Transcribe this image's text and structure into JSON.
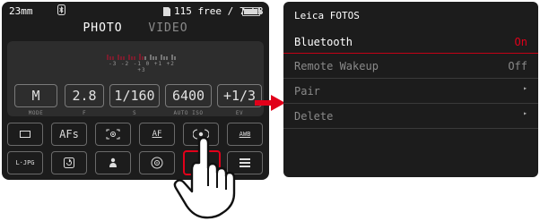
{
  "camera": {
    "focal_length": "23mm",
    "storage_status": "115 free / 7 GB",
    "tabs": [
      {
        "label": "PHOTO",
        "active": true
      },
      {
        "label": "VIDEO",
        "active": false
      }
    ],
    "ev_scale": "-3 -2 -1 0 +1 +2 +3",
    "params": [
      {
        "value": "M",
        "caption": "MODE"
      },
      {
        "value": "2.8",
        "caption": "F"
      },
      {
        "value": "1/160",
        "caption": "S"
      },
      {
        "value": "6400",
        "caption": "AUTO ISO"
      },
      {
        "value": "+1/3",
        "caption": "EV"
      }
    ],
    "quick_row1": [
      {
        "icon": "rect-frame-icon",
        "label": "▭"
      },
      {
        "icon": "af-mode",
        "label": "AFs"
      },
      {
        "icon": "metering-icon",
        "label": "[◉]"
      },
      {
        "icon": "af-settings-icon",
        "label": "AF"
      },
      {
        "icon": "stabilization-icon",
        "label": "((•))"
      },
      {
        "icon": "awb-icon",
        "label": "AWB"
      }
    ],
    "quick_row2": [
      {
        "icon": "file-format-icon",
        "label": "L·JPG"
      },
      {
        "icon": "refresh-icon",
        "label": "⟳"
      },
      {
        "icon": "person-icon",
        "label": "●"
      },
      {
        "icon": "timer-icon",
        "label": "⊙"
      },
      {
        "icon": "smartphone-icon",
        "label": "▯",
        "selected": true
      },
      {
        "icon": "menu-icon",
        "label": "≡"
      }
    ]
  },
  "menu": {
    "title": "Leica FOTOS",
    "items": [
      {
        "label": "Bluetooth",
        "value": "On"
      },
      {
        "label": "Remote Wakeup",
        "value": "Off"
      },
      {
        "label": "Pair",
        "value": ""
      },
      {
        "label": "Delete",
        "value": ""
      }
    ]
  },
  "colors": {
    "accent_red": "#e1001a",
    "screen_bg": "#1c1c1c",
    "panel_bg": "#2d2d2d"
  }
}
